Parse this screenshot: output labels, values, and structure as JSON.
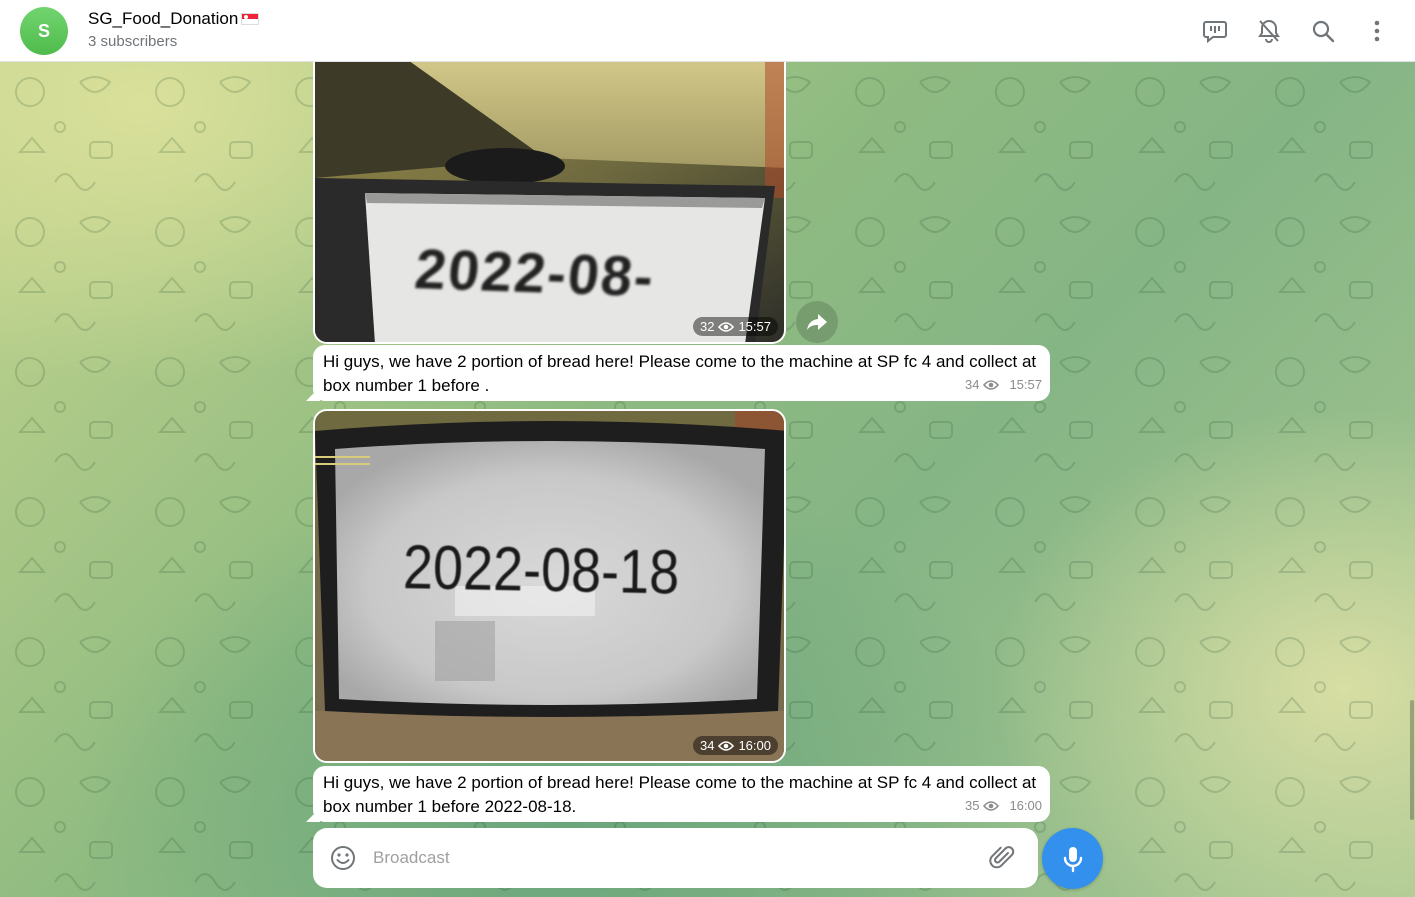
{
  "header": {
    "avatar_letter": "S",
    "title": "SG_Food_Donation",
    "subtitle": "3 subscribers",
    "icons": [
      "discuss-icon",
      "mute-bell-icon",
      "search-icon",
      "more-vertical-icon"
    ]
  },
  "messages": [
    {
      "type": "photo",
      "photo_text": "2022-08-",
      "views": "32",
      "time": "15:57"
    },
    {
      "type": "text",
      "text": "Hi guys, we have 2 portion of bread here! Please come to the machine at SP fc 4 and collect at box number 1 before .",
      "views": "34",
      "time": "15:57"
    },
    {
      "type": "photo",
      "photo_text": "2022-08-18",
      "views": "34",
      "time": "16:00"
    },
    {
      "type": "text",
      "text": "Hi guys, we have 2 portion of bread here! Please come to the machine at SP fc 4 and collect at box number 1 before 2022-08-18.",
      "views": "35",
      "time": "16:00"
    }
  ],
  "composer": {
    "placeholder": "Broadcast"
  },
  "colors": {
    "accent": "#3390ec",
    "avatar": "#5cc658"
  }
}
